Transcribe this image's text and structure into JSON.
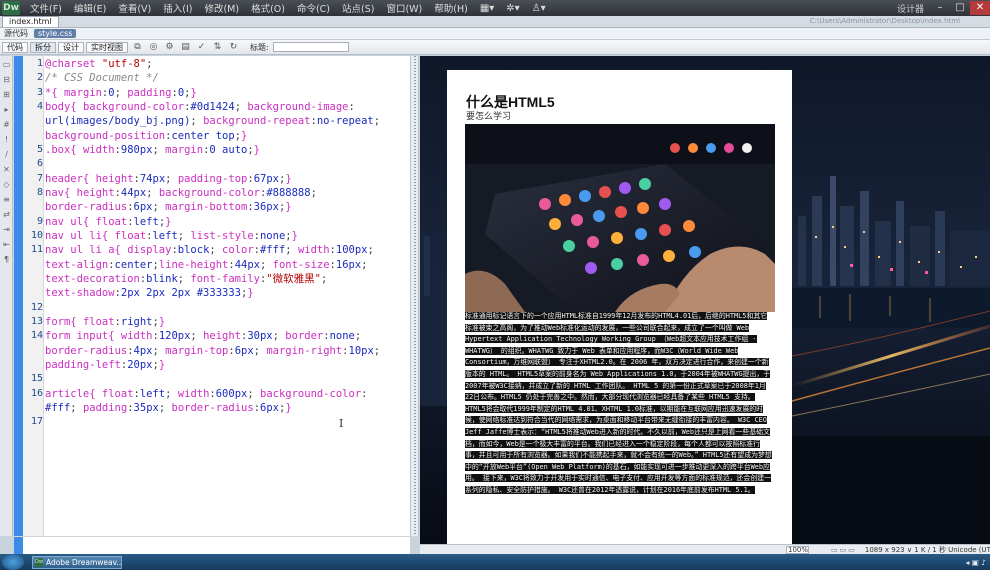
{
  "app": {
    "logo": "Dw",
    "menu": [
      "文件(F)",
      "编辑(E)",
      "查看(V)",
      "插入(I)",
      "修改(M)",
      "格式(O)",
      "命令(C)",
      "站点(S)",
      "窗口(W)",
      "帮助(H)"
    ],
    "workspace": "设计器"
  },
  "document": {
    "tab": "index.html",
    "path": "C:\\Users\\Administrator\\Desktop\\index.html",
    "related_files": [
      "源代码",
      "style.css"
    ]
  },
  "doc_toolbar": {
    "views": [
      "代码",
      "拆分",
      "设计",
      "实时视图"
    ],
    "active_view": "拆分",
    "title_label": "标题:"
  },
  "code": {
    "line_numbers": [
      "1",
      "2",
      "3",
      "4",
      "",
      "",
      "5",
      "6",
      "7",
      "8",
      "",
      "9",
      "10",
      "11",
      "",
      "",
      "",
      "12",
      "13",
      "14",
      "",
      "",
      "15",
      "16",
      "",
      "17"
    ]
  },
  "design": {
    "article_title": "什么是HTML5",
    "article_subtitle": "要怎么学习",
    "article_body": "标准通用标记语言下的一个应用HTML标准自1999年12月发布的HTML4.01后，后继的HTML5和其它标准被束之高阁，为了推动Web标准化运动的发展，一些公司联合起来，成立了一个叫做 Web Hypertext Application Technology Working Group （Web超文本应用技术工作组 -WHATWG） 的组织。WHATWG 致力于 Web 表单和应用程序，而W3C（World Wide Web Consortium，万维网联盟） 专注于XHTML2.0。在 2006 年，双方决定进行合作，来创建一个新版本的 HTML。 HTML5草案的前身名为 Web Applications 1.0，于2004年被WHATWG提出，于2007年被W3C接纳，并成立了新的 HTML 工作团队。 HTML 5 的第一份正式草案已于2008年1月22日公布。HTML5 仍处于完善之中。然而，大部分现代浏览器已经具备了某些 HTML5 支持。 HTML5将会取代1999年制定的HTML 4.01、XHTML 1.0标准，以期能在互联网应用迅速发展的时候，使网络标准达到符合当代的网络需求，为桌面和移动平台带来无缝衔接的丰富内容。 W3C CEO Jeff Jaffe博士表示：“HTML5将推动Web进入新的时代。不久以前，Web还只是上网看一些基础文档，而如今，Web是一个极大丰富的平台。我们已经进入一个稳定阶段，每个人都可以按照标准行事，并且可用于所有浏览器。如果我们不能携起手来，就不会有统一的Web。” HTML5还有望成为梦想中的“开放Web平台”(Open Web Platform)的基石，如能实现可进一步推动更深入的跨平台Web应用。 接下来，W3C将致力于开发用于实时通信、电子支付、应用开发等方面的标准规范，还会创建一系列的隐私、安全防护措施。 W3C还曾在2012年透露说，计划在2016年底前发布HTML 5.1。"
  },
  "status": {
    "zoom": "100%",
    "info": "1089 x 923 ∨ 1 K / 1 秒 Unicode (UTF-8)"
  },
  "taskbar": {
    "task": "Adobe Dreamweav..."
  },
  "colors": {
    "gutter_blue": "#3b8ce8",
    "selector": "#cc2ec1",
    "value": "#1a2bbd",
    "comment": "#888888"
  }
}
